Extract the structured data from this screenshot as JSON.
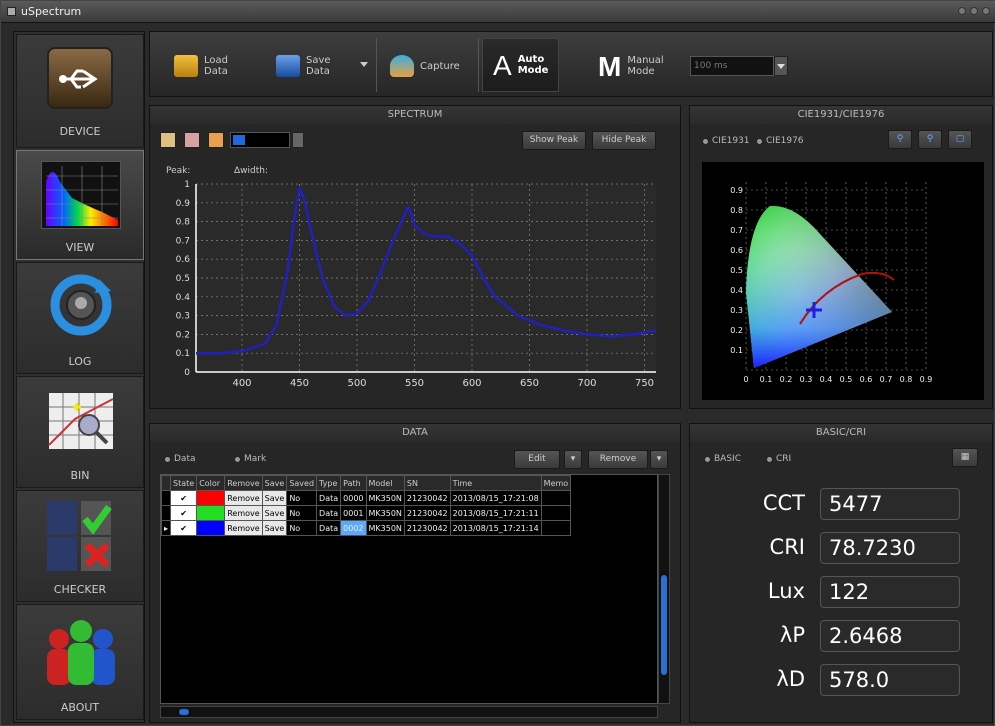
{
  "window": {
    "title": "uSpectrum"
  },
  "sidebar": {
    "items": [
      {
        "label": "DEVICE",
        "icon": "usb-icon"
      },
      {
        "label": "VIEW",
        "icon": "spectrum-icon"
      },
      {
        "label": "LOG",
        "icon": "sync-icon"
      },
      {
        "label": "BIN",
        "icon": "bin-icon"
      },
      {
        "label": "CHECKER",
        "icon": "checker-icon"
      },
      {
        "label": "ABOUT",
        "icon": "people-icon"
      }
    ]
  },
  "toolbar": {
    "load_line1": "Load",
    "load_line2": "Data",
    "save_line1": "Save",
    "save_line2": "Data",
    "capture": "Capture",
    "auto_line1": "Auto",
    "auto_line2": "Mode",
    "auto_letter": "A",
    "manual_line1": "Manual",
    "manual_line2": "Mode",
    "manual_letter": "M",
    "exposure_placeholder": "100 ms"
  },
  "spectrum": {
    "title": "SPECTRUM",
    "show_peak": "Show Peak",
    "hide_peak": "Hide Peak",
    "peak_label": "Peak:",
    "width_label": "Δwidth:"
  },
  "cie": {
    "title": "CIE1931/CIE1976",
    "opt1": "CIE1931",
    "opt2": "CIE1976",
    "xticks": [
      "0",
      "0.1",
      "0.2",
      "0.3",
      "0.4",
      "0.5",
      "0.6",
      "0.7",
      "0.8",
      "0.9"
    ],
    "yticks": [
      "0.9",
      "0.8",
      "0.7",
      "0.6",
      "0.5",
      "0.4",
      "0.3",
      "0.2",
      "0.1"
    ]
  },
  "data_panel": {
    "title": "DATA",
    "opt1": "Data",
    "opt2": "Mark",
    "edit": "Edit",
    "remove": "Remove",
    "headers": [
      "State",
      "Color",
      "Remove",
      "Save",
      "Saved",
      "Type",
      "Path",
      "Model",
      "SN",
      "Time",
      "Memo"
    ],
    "rows": [
      {
        "state": "✔",
        "color": "#ff0000",
        "remove": "Remove",
        "save": "Save",
        "saved": "No",
        "type": "Data",
        "path": "0000",
        "model": "MK350N",
        "sn": "21230042",
        "time": "2013/08/15_17:21:08"
      },
      {
        "state": "✔",
        "color": "#22dd22",
        "remove": "Remove",
        "save": "Save",
        "saved": "No",
        "type": "Data",
        "path": "0001",
        "model": "MK350N",
        "sn": "21230042",
        "time": "2013/08/15_17:21:11"
      },
      {
        "state": "✔",
        "color": "#0000ff",
        "remove": "Remove",
        "save": "Save",
        "saved": "No",
        "type": "Data",
        "path": "0002",
        "model": "MK350N",
        "sn": "21230042",
        "time": "2013/08/15_17:21:14"
      }
    ]
  },
  "basic": {
    "title": "BASIC/CRI",
    "opt1": "BASIC",
    "opt2": "CRI",
    "metrics": [
      {
        "label": "CCT",
        "value": "5477"
      },
      {
        "label": "CRI",
        "value": "78.7230"
      },
      {
        "label": "Lux",
        "value": "122"
      },
      {
        "label": "λP",
        "value": "2.6468"
      },
      {
        "label": "λD",
        "value": "578.0"
      }
    ]
  },
  "chart_data": {
    "type": "line",
    "title": "",
    "xlabel": "",
    "ylabel": "",
    "xlim": [
      360,
      760
    ],
    "ylim": [
      0,
      1
    ],
    "xticks": [
      400,
      450,
      500,
      550,
      600,
      650,
      700,
      750
    ],
    "yticks": [
      0,
      0.1,
      0.2,
      0.3,
      0.4,
      0.5,
      0.6,
      0.7,
      0.8,
      0.9,
      1
    ],
    "grid": true,
    "line_color": "#2020c0",
    "series": [
      {
        "x": [
          360,
          380,
          400,
          420,
          430,
          440,
          445,
          450,
          455,
          460,
          470,
          480,
          490,
          500,
          510,
          520,
          530,
          540,
          545,
          550,
          560,
          570,
          580,
          590,
          600,
          610,
          620,
          640,
          660,
          680,
          700,
          720,
          740,
          760
        ],
        "y": [
          0.1,
          0.1,
          0.11,
          0.15,
          0.25,
          0.55,
          0.8,
          0.98,
          0.9,
          0.75,
          0.5,
          0.35,
          0.3,
          0.31,
          0.38,
          0.52,
          0.68,
          0.82,
          0.88,
          0.78,
          0.73,
          0.72,
          0.72,
          0.68,
          0.62,
          0.5,
          0.4,
          0.3,
          0.25,
          0.22,
          0.2,
          0.19,
          0.2,
          0.22
        ]
      }
    ]
  }
}
